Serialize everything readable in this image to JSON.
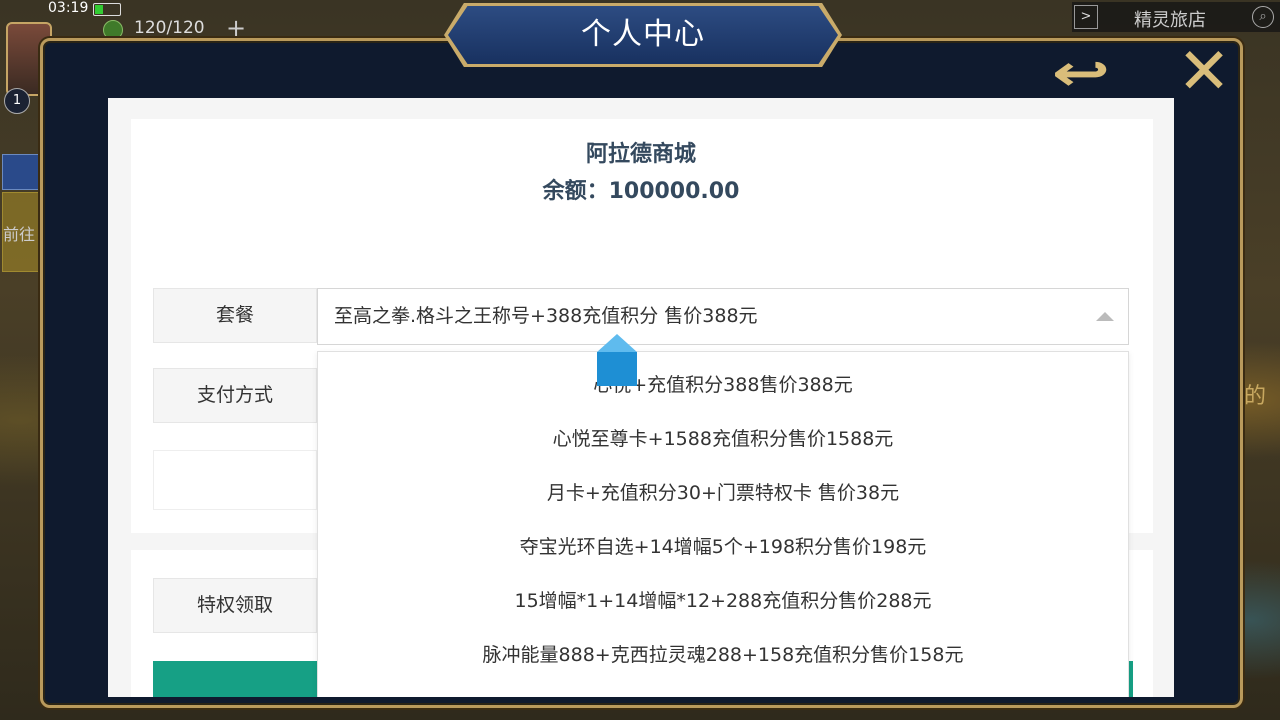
{
  "status_bar": {
    "time": "03:19",
    "hp": "120/120",
    "hp_plus": "+",
    "level": "1",
    "side_label": "前往"
  },
  "top_right": {
    "arrow": ">",
    "shop_name": "精灵旅店",
    "search_icon": "search-icon"
  },
  "right_edge_text": "的",
  "modal": {
    "title": "个人中心",
    "back_icon": "back-arrow-icon",
    "close_icon": "close-x-icon"
  },
  "page": {
    "shop_title": "阿拉德商城",
    "balance": "余额：100000.00",
    "package_label": "套餐",
    "payment_label": "支付方式",
    "privilege_label": "特权领取",
    "selected_package": "至高之拳.格斗之王称号+388充值积分 售价388元",
    "options": [
      "心悦+充值积分388售价388元",
      "心悦至尊卡+1588充值积分售价1588元",
      "月卡+充值积分30+门票特权卡 售价38元",
      "夺宝光环自选+14增幅5个+198积分售价198元",
      "15增幅*1+14增幅*12+288充值积分售价288元",
      "脉冲能量888+克西拉灵魂288+158充值积分售价158元"
    ]
  },
  "colors": {
    "accent": "#16a085",
    "title_text": "#34495e",
    "frame_gold": "#b99a5c",
    "frame_bg": "#0f1a2e"
  }
}
